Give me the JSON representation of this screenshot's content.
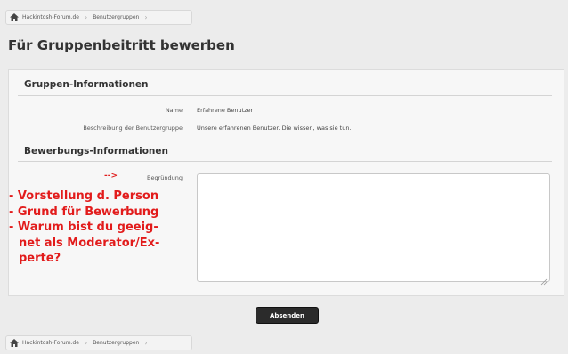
{
  "breadcrumb": {
    "items": [
      "Hackintosh-Forum.de",
      "Benutzergruppen"
    ]
  },
  "page_title": "Für Gruppenbeitritt bewerben",
  "group_info": {
    "heading": "Gruppen-Informationen",
    "name_label": "Name",
    "name_value": "Erfahrene Benutzer",
    "desc_label": "Beschreibung der Benutzergruppe",
    "desc_value": "Unsere erfahrenen Benutzer. Die wissen, was sie tun."
  },
  "application_info": {
    "heading": "Bewerbungs-Informationen",
    "reason_label": "Begründung",
    "reason_value": ""
  },
  "annotation": {
    "arrow": "-->",
    "lines": [
      "- Vorstellung d. Person",
      "- Grund für Bewerbung",
      "- Warum bist du geeig-",
      "net als Moderator/Ex-",
      "perte?"
    ],
    "color": "#e21b1b"
  },
  "submit_label": "Absenden",
  "icons": {
    "home": "home-icon",
    "resize": "resize-grip-icon"
  }
}
